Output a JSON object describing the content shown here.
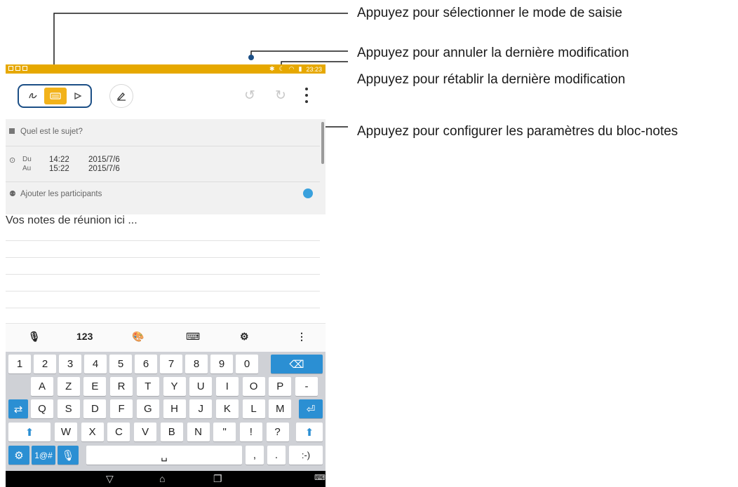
{
  "callouts": {
    "input_mode": "Appuyez pour sélectionner le mode de saisie",
    "undo": "Appuyez pour annuler la dernière modification",
    "redo": "Appuyez pour rétablir la dernière modification",
    "settings": "Appuyez pour configurer les paramètres du bloc-notes"
  },
  "colors": {
    "status_bar": "#e6a800",
    "active_mode": "#f2b21a",
    "callout_border": "#1c4f86",
    "key_accent": "#2b8fd3"
  },
  "status": {
    "time": "23:23"
  },
  "note_form": {
    "subject_placeholder": "Quel est le sujet?",
    "from_label": "Du",
    "from_time": "14:22",
    "from_date": "2015/7/6",
    "to_label": "Au",
    "to_time": "15:22",
    "to_date": "2015/7/6",
    "participants_placeholder": "Ajouter les participants",
    "notes_placeholder": "Vos notes de réunion ici ..."
  },
  "keyboard_toolbar": {
    "numbers_label": "123"
  },
  "keyboard": {
    "row1": [
      "1",
      "2",
      "3",
      "4",
      "5",
      "6",
      "7",
      "8",
      "9",
      "0"
    ],
    "row2": [
      "A",
      "Z",
      "E",
      "R",
      "T",
      "Y",
      "U",
      "I",
      "O",
      "P",
      "-"
    ],
    "row3": [
      "Q",
      "S",
      "D",
      "F",
      "G",
      "H",
      "J",
      "K",
      "L",
      "M"
    ],
    "row4": [
      "W",
      "X",
      "C",
      "V",
      "B",
      "N",
      "\"",
      "!",
      "?"
    ],
    "symbols_label": "1@#",
    "comma": ",",
    "period": ".",
    "smiley": ":-)"
  }
}
